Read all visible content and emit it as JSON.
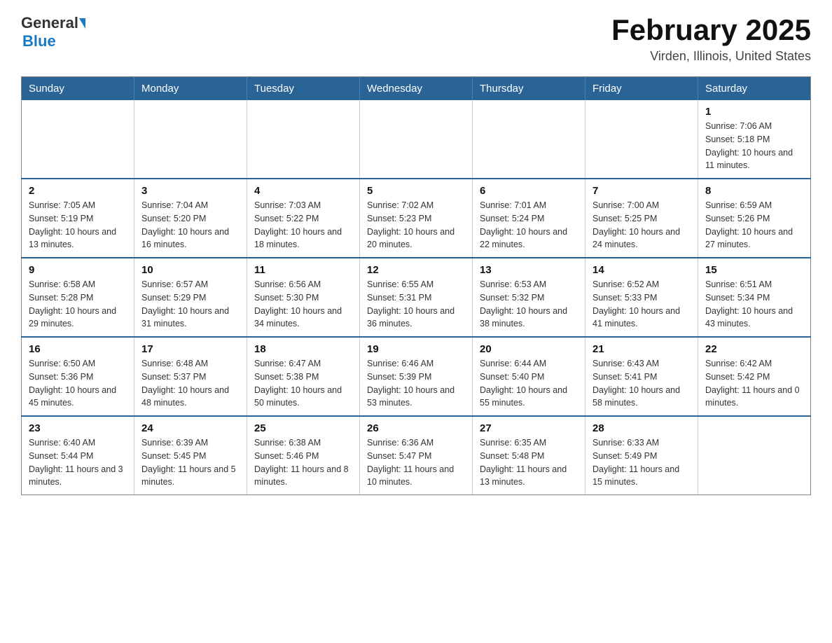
{
  "header": {
    "logo": {
      "general": "General",
      "blue": "Blue"
    },
    "month": "February 2025",
    "location": "Virden, Illinois, United States"
  },
  "days_of_week": [
    "Sunday",
    "Monday",
    "Tuesday",
    "Wednesday",
    "Thursday",
    "Friday",
    "Saturday"
  ],
  "weeks": [
    [
      {
        "day": "",
        "info": ""
      },
      {
        "day": "",
        "info": ""
      },
      {
        "day": "",
        "info": ""
      },
      {
        "day": "",
        "info": ""
      },
      {
        "day": "",
        "info": ""
      },
      {
        "day": "",
        "info": ""
      },
      {
        "day": "1",
        "info": "Sunrise: 7:06 AM\nSunset: 5:18 PM\nDaylight: 10 hours and 11 minutes."
      }
    ],
    [
      {
        "day": "2",
        "info": "Sunrise: 7:05 AM\nSunset: 5:19 PM\nDaylight: 10 hours and 13 minutes."
      },
      {
        "day": "3",
        "info": "Sunrise: 7:04 AM\nSunset: 5:20 PM\nDaylight: 10 hours and 16 minutes."
      },
      {
        "day": "4",
        "info": "Sunrise: 7:03 AM\nSunset: 5:22 PM\nDaylight: 10 hours and 18 minutes."
      },
      {
        "day": "5",
        "info": "Sunrise: 7:02 AM\nSunset: 5:23 PM\nDaylight: 10 hours and 20 minutes."
      },
      {
        "day": "6",
        "info": "Sunrise: 7:01 AM\nSunset: 5:24 PM\nDaylight: 10 hours and 22 minutes."
      },
      {
        "day": "7",
        "info": "Sunrise: 7:00 AM\nSunset: 5:25 PM\nDaylight: 10 hours and 24 minutes."
      },
      {
        "day": "8",
        "info": "Sunrise: 6:59 AM\nSunset: 5:26 PM\nDaylight: 10 hours and 27 minutes."
      }
    ],
    [
      {
        "day": "9",
        "info": "Sunrise: 6:58 AM\nSunset: 5:28 PM\nDaylight: 10 hours and 29 minutes."
      },
      {
        "day": "10",
        "info": "Sunrise: 6:57 AM\nSunset: 5:29 PM\nDaylight: 10 hours and 31 minutes."
      },
      {
        "day": "11",
        "info": "Sunrise: 6:56 AM\nSunset: 5:30 PM\nDaylight: 10 hours and 34 minutes."
      },
      {
        "day": "12",
        "info": "Sunrise: 6:55 AM\nSunset: 5:31 PM\nDaylight: 10 hours and 36 minutes."
      },
      {
        "day": "13",
        "info": "Sunrise: 6:53 AM\nSunset: 5:32 PM\nDaylight: 10 hours and 38 minutes."
      },
      {
        "day": "14",
        "info": "Sunrise: 6:52 AM\nSunset: 5:33 PM\nDaylight: 10 hours and 41 minutes."
      },
      {
        "day": "15",
        "info": "Sunrise: 6:51 AM\nSunset: 5:34 PM\nDaylight: 10 hours and 43 minutes."
      }
    ],
    [
      {
        "day": "16",
        "info": "Sunrise: 6:50 AM\nSunset: 5:36 PM\nDaylight: 10 hours and 45 minutes."
      },
      {
        "day": "17",
        "info": "Sunrise: 6:48 AM\nSunset: 5:37 PM\nDaylight: 10 hours and 48 minutes."
      },
      {
        "day": "18",
        "info": "Sunrise: 6:47 AM\nSunset: 5:38 PM\nDaylight: 10 hours and 50 minutes."
      },
      {
        "day": "19",
        "info": "Sunrise: 6:46 AM\nSunset: 5:39 PM\nDaylight: 10 hours and 53 minutes."
      },
      {
        "day": "20",
        "info": "Sunrise: 6:44 AM\nSunset: 5:40 PM\nDaylight: 10 hours and 55 minutes."
      },
      {
        "day": "21",
        "info": "Sunrise: 6:43 AM\nSunset: 5:41 PM\nDaylight: 10 hours and 58 minutes."
      },
      {
        "day": "22",
        "info": "Sunrise: 6:42 AM\nSunset: 5:42 PM\nDaylight: 11 hours and 0 minutes."
      }
    ],
    [
      {
        "day": "23",
        "info": "Sunrise: 6:40 AM\nSunset: 5:44 PM\nDaylight: 11 hours and 3 minutes."
      },
      {
        "day": "24",
        "info": "Sunrise: 6:39 AM\nSunset: 5:45 PM\nDaylight: 11 hours and 5 minutes."
      },
      {
        "day": "25",
        "info": "Sunrise: 6:38 AM\nSunset: 5:46 PM\nDaylight: 11 hours and 8 minutes."
      },
      {
        "day": "26",
        "info": "Sunrise: 6:36 AM\nSunset: 5:47 PM\nDaylight: 11 hours and 10 minutes."
      },
      {
        "day": "27",
        "info": "Sunrise: 6:35 AM\nSunset: 5:48 PM\nDaylight: 11 hours and 13 minutes."
      },
      {
        "day": "28",
        "info": "Sunrise: 6:33 AM\nSunset: 5:49 PM\nDaylight: 11 hours and 15 minutes."
      },
      {
        "day": "",
        "info": ""
      }
    ]
  ]
}
